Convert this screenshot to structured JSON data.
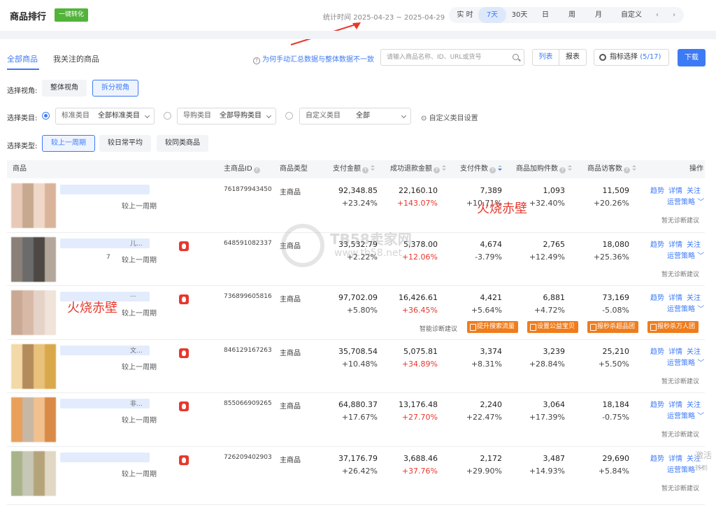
{
  "header": {
    "title": "商品排行",
    "convert_label": "一键转化",
    "stat_time_label": "统计时间",
    "stat_time_range": "2025-04-23 ~ 2025-04-29",
    "time_options": [
      "实 时",
      "7天",
      "30天",
      "日",
      "周",
      "月",
      "自定义"
    ],
    "active_time": "7天"
  },
  "tabs": [
    {
      "label": "全部商品",
      "active": true
    },
    {
      "label": "我关注的商品",
      "active": false
    }
  ],
  "help_link": "为何手动汇总数据与整体数据不一致",
  "search": {
    "placeholder": "请输入商品名称、ID、URL或货号"
  },
  "view_toggle": {
    "list": "列表",
    "report": "报表"
  },
  "metric_select": {
    "label": "指标选择",
    "count": "(5/17)"
  },
  "download_label": "下载",
  "perspective": {
    "label": "选择视角:",
    "options": [
      "整体视角",
      "拆分视角"
    ],
    "active": "拆分视角"
  },
  "category": {
    "label": "选择类目:",
    "standard": {
      "key": "标准类目",
      "value": "全部标准类目"
    },
    "guide": {
      "key": "导购类目",
      "value": "全部导购类目"
    },
    "custom": {
      "key": "自定义类目",
      "value": "全部"
    },
    "custom_config": "自定义类目设置"
  },
  "compare_type": {
    "label": "选择类型:",
    "options": [
      "较上一周期",
      "较日常平均",
      "较同类商品"
    ],
    "active": "较上一周期"
  },
  "table": {
    "headers": [
      "商品",
      "主商品ID",
      "商品类型",
      "支付金额",
      "成功退款金额",
      "支付件数",
      "商品加购件数",
      "商品访客数",
      "操作"
    ],
    "compare_text": "较上一周期",
    "ops": [
      "趋势",
      "详情",
      "关注"
    ],
    "strategy": "运营策略",
    "no_diag": "暂无诊断建议",
    "diag_label": "智能诊断建议",
    "diag_buttons": [
      "提升搜索流量",
      "设置公益宝贝",
      "报秒杀超品团",
      "报秒杀万人团"
    ],
    "rows": [
      {
        "id": "761879943450",
        "type": "主商品",
        "pay": "92,348.85",
        "pay_pct": "+23.24%",
        "refund": "22,160.10",
        "refund_pct": "+143.07%",
        "qty": "7,389",
        "qty_pct": "+10.71%",
        "cart": "1,093",
        "cart_pct": "+32.40%",
        "visitors": "11,509",
        "visitors_pct": "+20.26%",
        "fire": false,
        "name_frag": "",
        "name_extra": ""
      },
      {
        "id": "648591082337",
        "type": "主商品",
        "pay": "33,532.79",
        "pay_pct": "+2.22%",
        "refund": "5,378.00",
        "refund_pct": "+12.06%",
        "qty": "4,674",
        "qty_pct": "-3.79%",
        "cart": "2,765",
        "cart_pct": "+12.49%",
        "visitors": "18,080",
        "visitors_pct": "+25.36%",
        "fire": true,
        "name_frag": "儿...",
        "name_extra": "7"
      },
      {
        "id": "736899605816",
        "type": "主商品",
        "pay": "97,702.09",
        "pay_pct": "+5.80%",
        "refund": "16,426.61",
        "refund_pct": "+36.45%",
        "qty": "4,421",
        "qty_pct": "+5.64%",
        "cart": "6,881",
        "cart_pct": "+4.72%",
        "visitors": "73,169",
        "visitors_pct": "-5.08%",
        "fire": true,
        "name_frag": "...",
        "name_extra": ""
      },
      {
        "id": "846129167263",
        "type": "主商品",
        "pay": "35,708.54",
        "pay_pct": "+10.48%",
        "refund": "5,075.81",
        "refund_pct": "+34.89%",
        "qty": "3,374",
        "qty_pct": "+8.31%",
        "cart": "3,239",
        "cart_pct": "+28.84%",
        "visitors": "25,210",
        "visitors_pct": "+5.50%",
        "fire": true,
        "name_frag": "文...",
        "name_extra": ""
      },
      {
        "id": "855066909265",
        "type": "主商品",
        "pay": "64,880.37",
        "pay_pct": "+17.67%",
        "refund": "13,176.48",
        "refund_pct": "+27.70%",
        "qty": "2,240",
        "qty_pct": "+22.47%",
        "cart": "3,064",
        "cart_pct": "+17.39%",
        "visitors": "18,184",
        "visitors_pct": "-0.75%",
        "fire": true,
        "name_frag": "非...",
        "name_extra": ""
      },
      {
        "id": "726209402903",
        "type": "主商品",
        "pay": "37,176.79",
        "pay_pct": "+26.42%",
        "refund": "3,688.46",
        "refund_pct": "+37.76%",
        "qty": "2,172",
        "qty_pct": "+29.90%",
        "cart": "3,487",
        "cart_pct": "+14.93%",
        "visitors": "29,690",
        "visitors_pct": "+5.84%",
        "fire": true,
        "name_frag": "",
        "name_extra": ""
      }
    ]
  },
  "watermarks": {
    "red_text": "火烧赤壁",
    "site_name": "TB58卖家网",
    "site_url": "www.tb58.net",
    "corner_text": "激活",
    "corner_sub": "转到"
  },
  "colors": {
    "accent": "#3d7af5",
    "green": "#52b33a",
    "red": "#e8372c",
    "orange": "#f07c1c"
  }
}
